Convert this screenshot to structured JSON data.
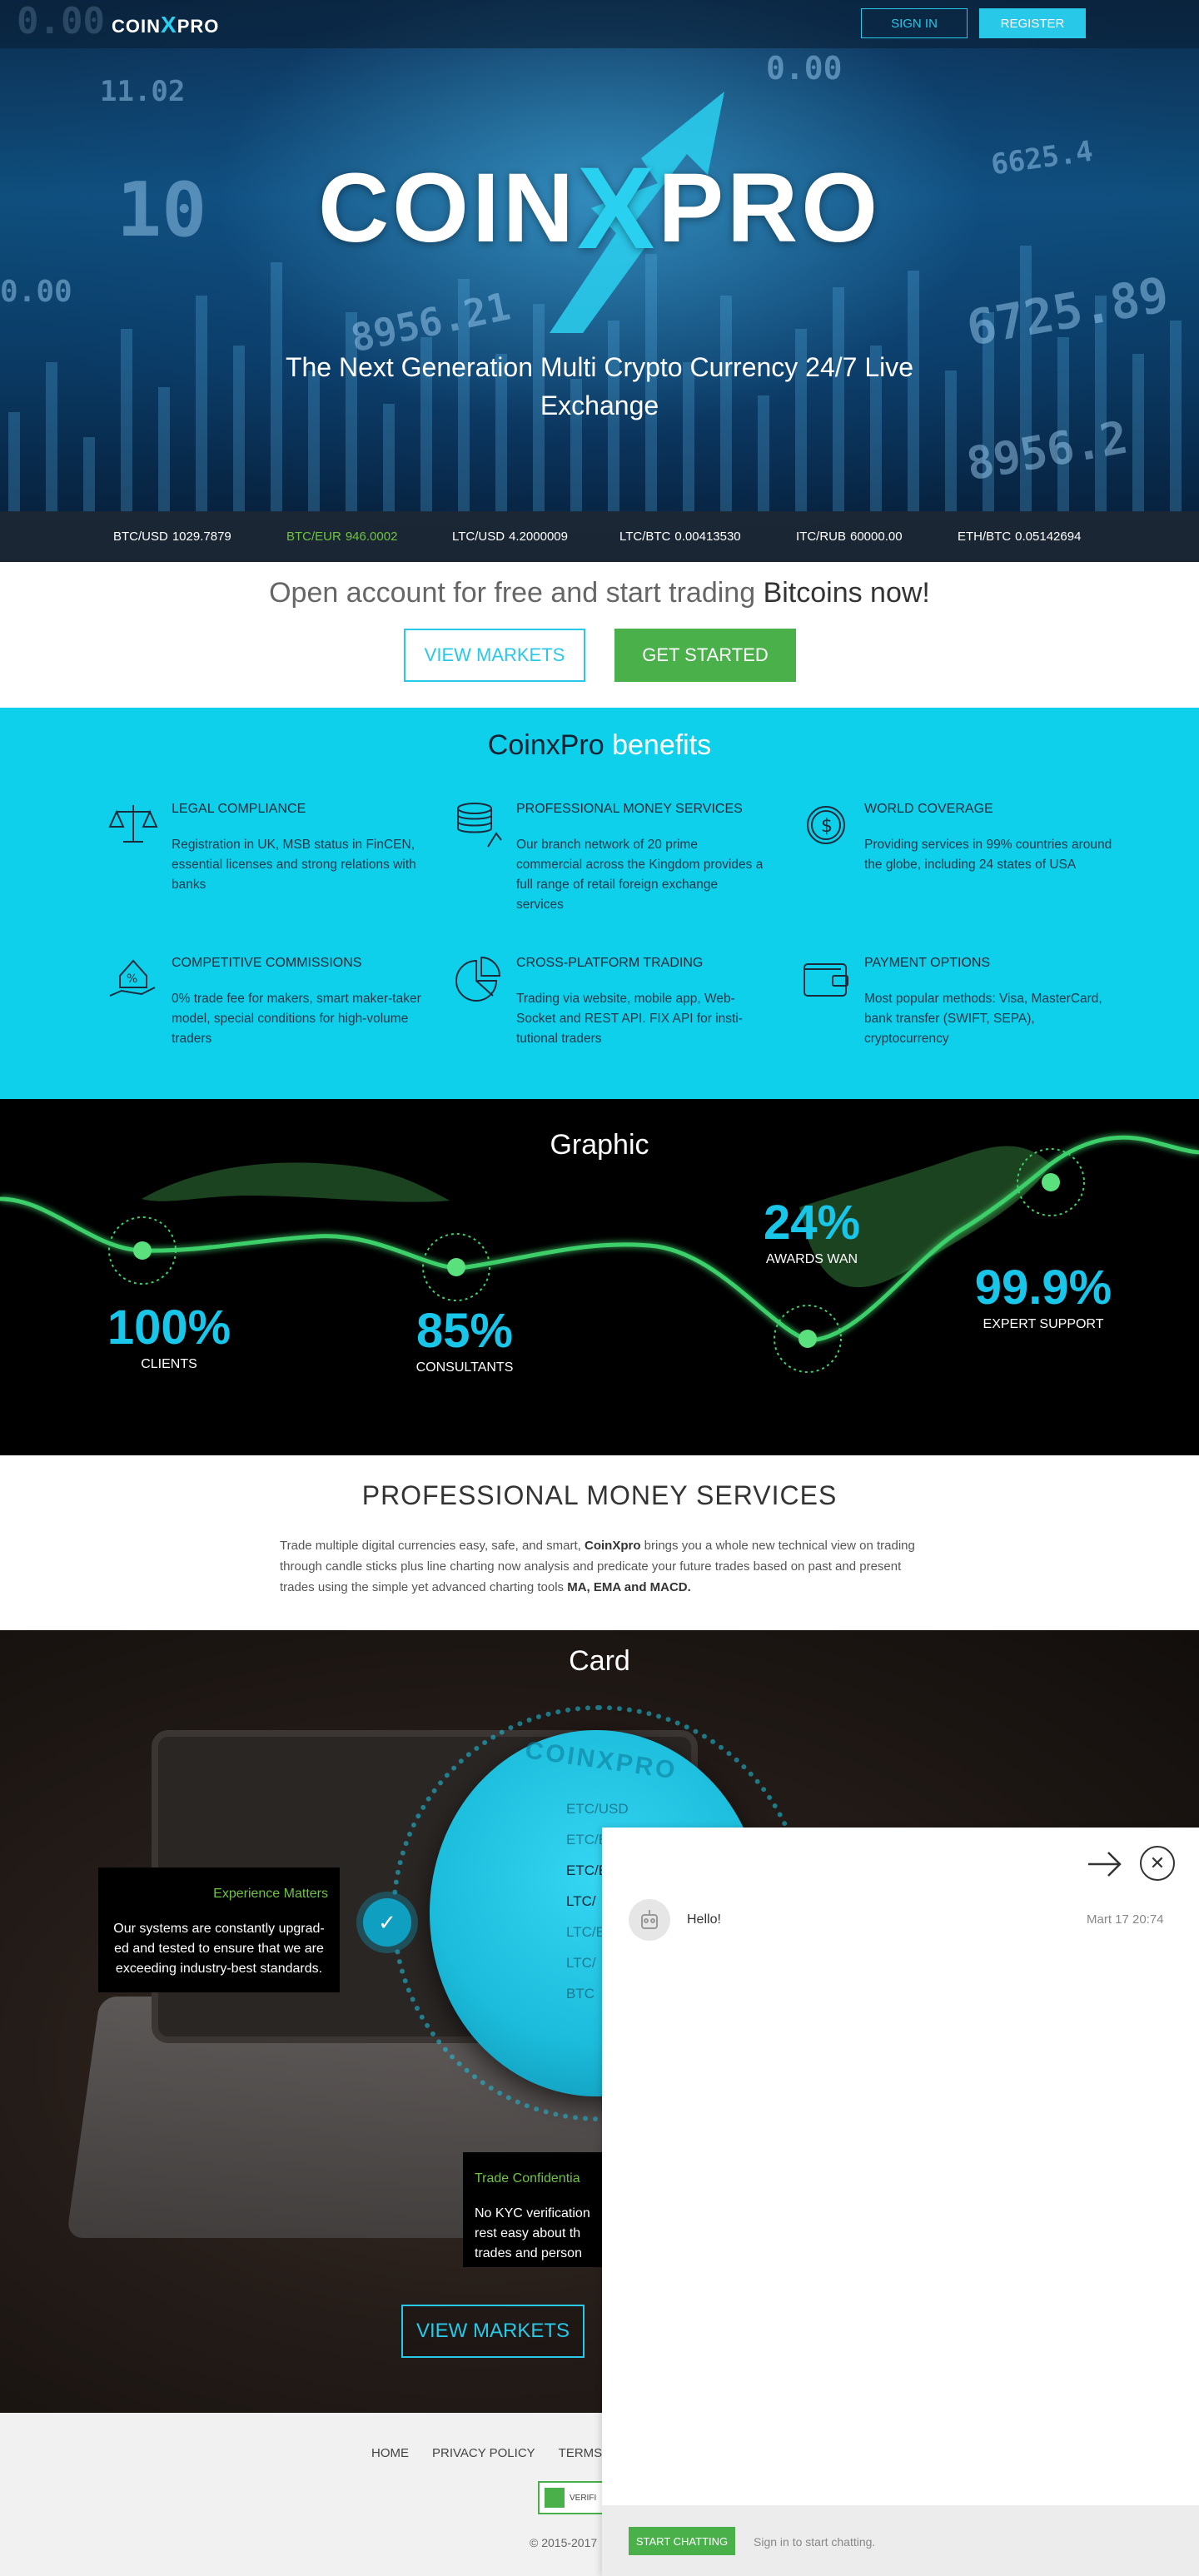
{
  "header": {
    "logo": "COINXPRO",
    "signin_label": "SIGN IN",
    "register_label": "REGISTER"
  },
  "hero": {
    "logo_big": "COINXPRO",
    "tagline": "The Next Generation Multi Crypto Currency 24/7 Live Exchange"
  },
  "ticker": [
    {
      "pair": "BTC/USD",
      "value": "1029.7879",
      "highlight": false
    },
    {
      "pair": "BTC/EUR",
      "value": "946.0002",
      "highlight": true
    },
    {
      "pair": "LTC/USD",
      "value": "4.2000009",
      "highlight": false
    },
    {
      "pair": "LTC/BTC",
      "value": "0.00413530",
      "highlight": false
    },
    {
      "pair": "ITC/RUB",
      "value": "60000.00",
      "highlight": false
    },
    {
      "pair": "ETH/BTC",
      "value": "0.05142694",
      "highlight": false
    }
  ],
  "open_account": {
    "headline": "Open account for free and start trading ",
    "headline_strong": "Bitcoins now!",
    "view_markets_label": "VIEW MARKETS",
    "get_started_label": "GET STARTED"
  },
  "benefits": {
    "title_a": "CoinxPro",
    "title_b": "benefits",
    "items": [
      {
        "icon": "scales-icon",
        "title": "LEGAL COMPLIANCE",
        "desc": "Registration in UK, MSB status in FinCEN, essential licenses and strong relations with banks"
      },
      {
        "icon": "coin-stack-icon",
        "title": "PROFESSIONAL MONEY SERVICES",
        "desc": "Our branch network of 20 prime commercial across the Kingdom provides a full range of retail foreign exchange services"
      },
      {
        "icon": "dollar-circle-icon",
        "title": "WORLD COVERAGE",
        "desc": "Providing services in 99% countries around the globe, including 24 states of USA"
      },
      {
        "icon": "percent-hand-icon",
        "title": "COMPETITIVE COMMISSIONS",
        "desc": "0% trade fee for makers, smart maker-taker model, special conditions for high-volume traders"
      },
      {
        "icon": "pie-chart-icon",
        "title": "CROSS-PLATFORM TRADING",
        "desc": "Trading via website, mobile app, Web-Socket and REST API. FIX API for insti-tutional traders"
      },
      {
        "icon": "wallet-icon",
        "title": "PAYMENT OPTIONS",
        "desc": "Most popular methods: Visa, MasterCard, bank transfer (SWIFT, SEPA), cryptocurrency"
      }
    ]
  },
  "graphic": {
    "title": "Graphic",
    "stats": [
      {
        "value": "100%",
        "label": "CLIENTS"
      },
      {
        "value": "85%",
        "label": "CONSULTANTS"
      },
      {
        "value": "24%",
        "label": "AWARDS WAN"
      },
      {
        "value": "99.9%",
        "label": "EXPERT SUPPORT"
      }
    ]
  },
  "pro": {
    "title": "PROFESSIONAL MONEY SERVICES",
    "p1": "Trade multiple digital currencies easy, safe, and smart, ",
    "brand": "CoinXpro",
    "p2": " brings you a whole new technical view on trading through candle sticks plus line charting now analysis and predicate your future trades based on past and present trades using the simple yet advanced charting tools ",
    "tools": "MA, EMA and MACD."
  },
  "card": {
    "title": "Card",
    "coin_brand": "COINXPRO",
    "coin_pairs": [
      "ETC/USD",
      "ETC/E",
      "ETC/E",
      "LTC/",
      "LTC/E",
      "LTC/",
      "BTC"
    ],
    "box1_title": "Experience Matters",
    "box1_text": "Our systems are constantly upgrad-ed and tested to ensure that we are exceeding industry-best standards.",
    "box2_title": "Trade Confidentia",
    "box2_text_1": "No KYC verification",
    "box2_text_2": "rest easy about th",
    "box2_text_3": "trades and person",
    "view_markets_label": "VIEW MARKETS"
  },
  "footer": {
    "links": [
      "HOME",
      "PRIVACY POLICY",
      "TERMS C"
    ],
    "badge": "VERIFI",
    "copyright": "© 2015-2017"
  },
  "chat": {
    "message": "Hello!",
    "time": "Mart 17 20:74",
    "start_label": "START CHATTING",
    "hint": "Sign in to start chatting."
  },
  "colors": {
    "accent": "#28c8e8",
    "green": "#4ab04a",
    "benefits_bg": "#0fd0ea"
  }
}
